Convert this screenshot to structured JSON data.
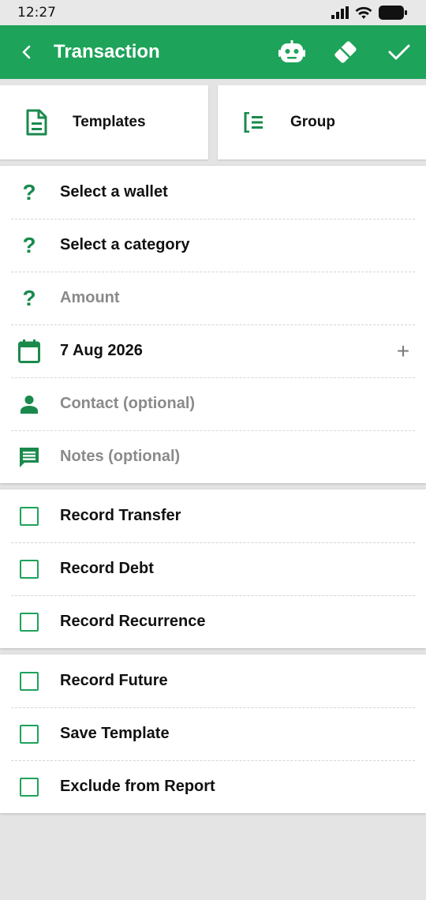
{
  "status": {
    "time": "12:27"
  },
  "appbar": {
    "title": "Transaction"
  },
  "top_cards": {
    "templates": "Templates",
    "group": "Group"
  },
  "fields": {
    "wallet": "Select a wallet",
    "category": "Select a category",
    "amount": "Amount",
    "date": "7 Aug 2026",
    "contact": "Contact (optional)",
    "notes": "Notes (optional)"
  },
  "options1": {
    "transfer": "Record Transfer",
    "debt": "Record Debt",
    "recurrence": "Record Recurrence"
  },
  "options2": {
    "future": "Record Future",
    "template": "Save Template",
    "exclude": "Exclude from Report"
  },
  "colors": {
    "accent": "#1ea35a",
    "icon": "#1a8a4c"
  }
}
